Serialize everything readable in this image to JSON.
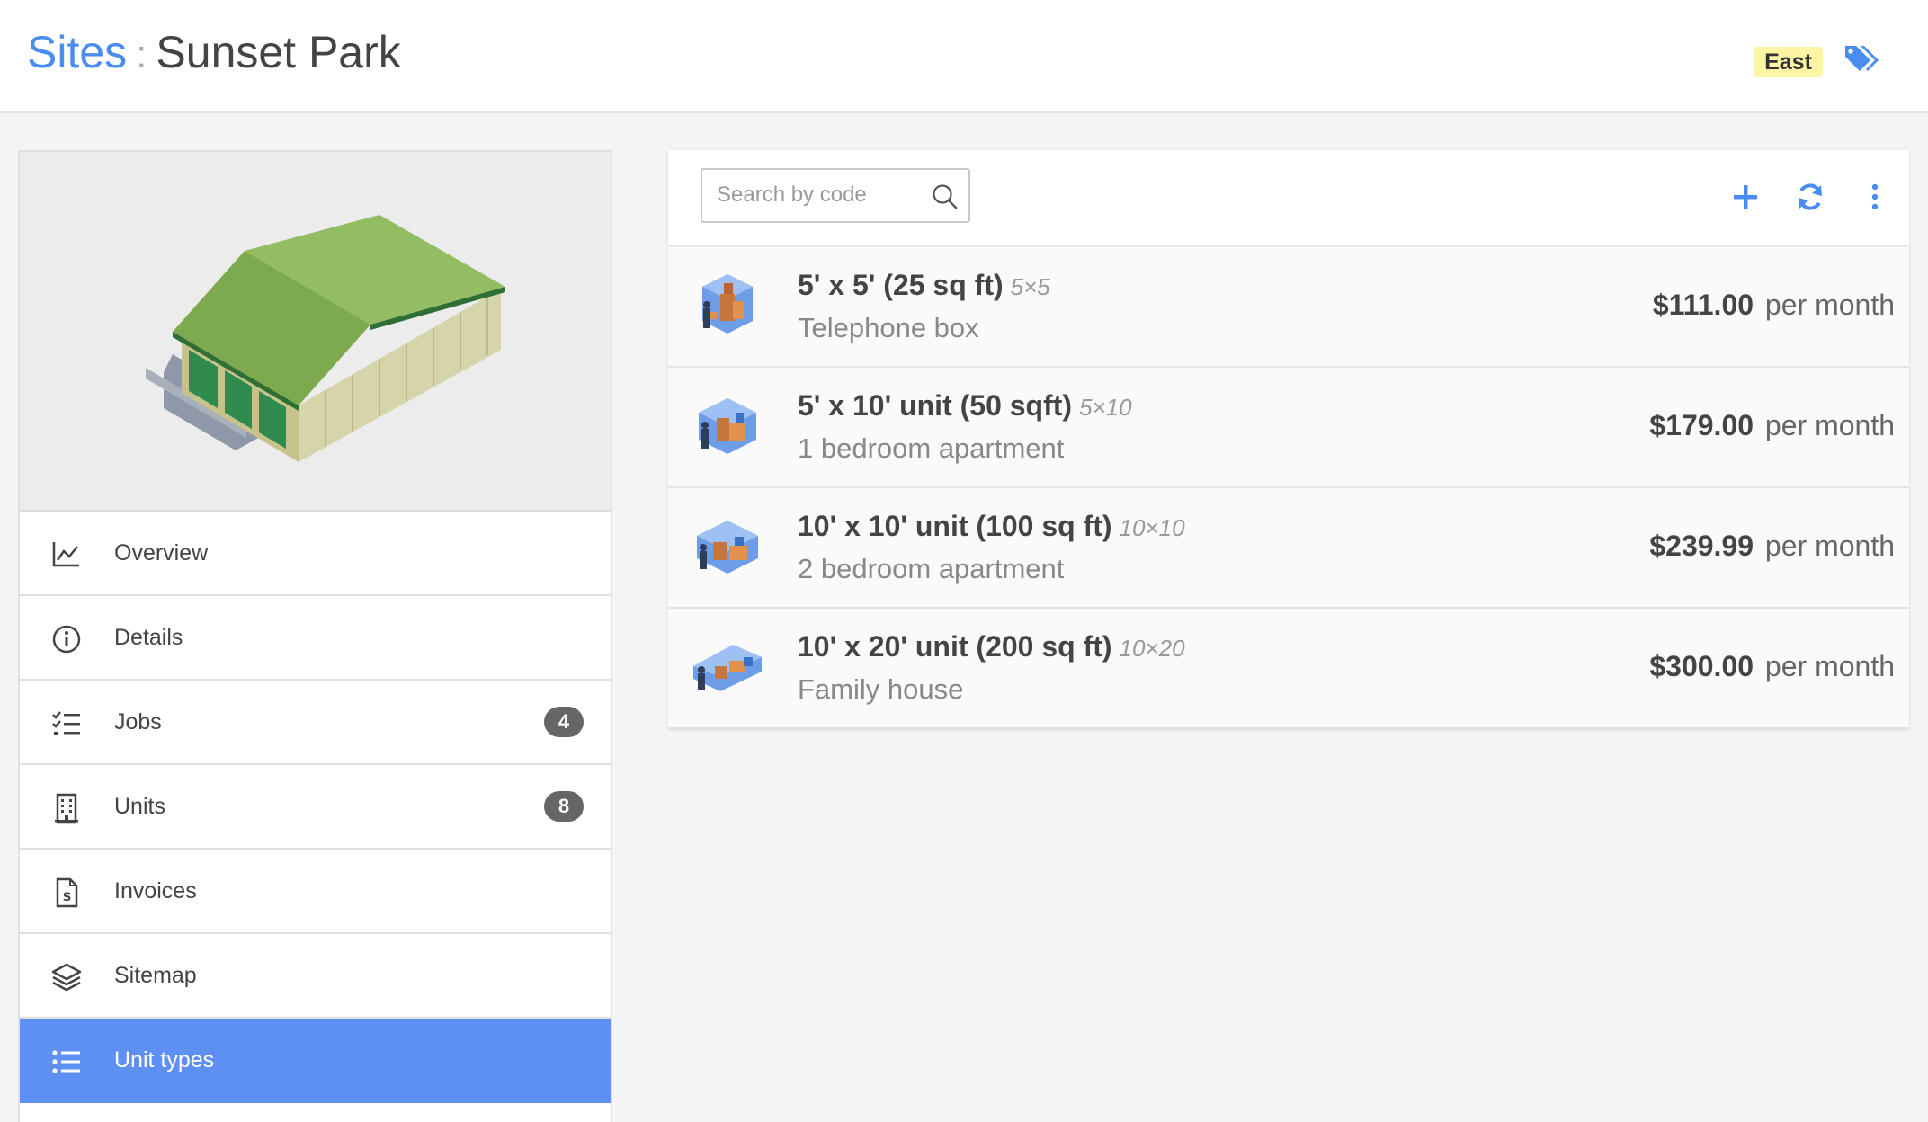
{
  "header": {
    "breadcrumb_root": "Sites",
    "separator": ":",
    "breadcrumb_current": "Sunset Park",
    "region_badge": "East",
    "tag_icon": "tags-icon",
    "accent_color": "#4a8df0",
    "badge_color": "#fbf5a4"
  },
  "sidebar": {
    "items": [
      {
        "label": "Overview",
        "icon": "chart-line-icon"
      },
      {
        "label": "Details",
        "icon": "info-circle-icon"
      },
      {
        "label": "Jobs",
        "icon": "checklist-icon",
        "badge": "4"
      },
      {
        "label": "Units",
        "icon": "building-icon",
        "badge": "8"
      },
      {
        "label": "Invoices",
        "icon": "invoice-icon"
      },
      {
        "label": "Sitemap",
        "icon": "layers-icon"
      },
      {
        "label": "Unit types",
        "icon": "list-icon",
        "active": true
      }
    ],
    "active_color": "#5e8ff2"
  },
  "toolbar": {
    "search_placeholder": "Search by code",
    "add_icon": "plus-icon",
    "refresh_icon": "refresh-icon",
    "more_icon": "more-vertical-icon"
  },
  "unit_types": [
    {
      "title": "5' x 5' (25 sq ft)",
      "code": "5×5",
      "description": "Telephone box",
      "price": "$111.00",
      "period": "per month"
    },
    {
      "title": "5' x 10' unit (50 sqft)",
      "code": "5×10",
      "description": "1 bedroom apartment",
      "price": "$179.00",
      "period": "per month"
    },
    {
      "title": "10' x 10' unit (100 sq ft)",
      "code": "10×10",
      "description": "2 bedroom apartment",
      "price": "$239.99",
      "period": "per month"
    },
    {
      "title": "10' x 20' unit (200 sq ft)",
      "code": "10×20",
      "description": "Family house",
      "price": "$300.00",
      "period": "per month"
    }
  ]
}
